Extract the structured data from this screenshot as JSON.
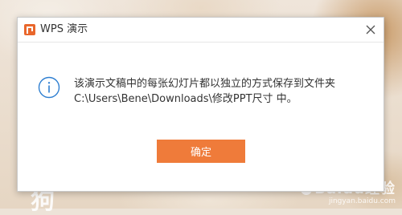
{
  "dialog": {
    "title": "WPS 演示",
    "message_line1": "该演示文稿中的每张幻灯片都以独立的方式保存到文件夹",
    "message_line2": "C:\\Users\\Bene\\Downloads\\修改PPT尺寸 中。",
    "ok_label": "确定",
    "accent_color": "#ef7b3a",
    "info_icon_color": "#2f7fd1"
  },
  "icons": {
    "app": "wps-presentation-logo-icon",
    "info": "info-icon",
    "close": "close-icon"
  },
  "watermark": {
    "brand": "Baidu经验",
    "url": "jingyan.baidu.com"
  },
  "background": {
    "corner_text": "狗"
  }
}
